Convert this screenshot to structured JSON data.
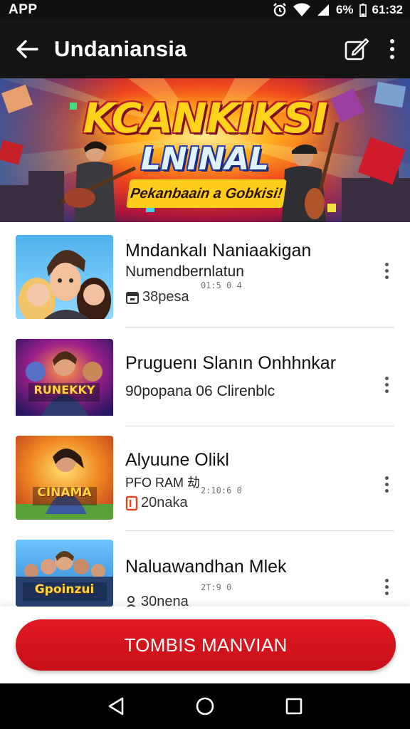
{
  "status_bar": {
    "app_label": "APP",
    "battery_text": "6%",
    "time": "61:32"
  },
  "app_bar": {
    "title": "Undaniansia"
  },
  "banner": {
    "title_line1": "KCANKIKSI",
    "title_line2": "LNINAL",
    "subtitle": "Pekanbaain a Gobkisi!"
  },
  "items": [
    {
      "title": "Mndankalı Naniaakigan",
      "subtitle": "Numendbernlatun",
      "tiny": "01:5 0 4",
      "meta_text": "38pesa",
      "meta_icon": "store-icon"
    },
    {
      "title": "Pruguenı Slanın Onhhnkar",
      "subtitle": "90popana 06 Clirenblc",
      "tiny": "",
      "meta_text": "",
      "meta_icon": ""
    },
    {
      "title": "Alyuune Olikl",
      "subtitle": "PFO RAM 劫",
      "tiny": "2:10:6 0",
      "meta_text": "20naka",
      "meta_icon": "box-icon"
    },
    {
      "title": "Naluawandhan Mlek",
      "subtitle": "",
      "tiny": "2T:9 0",
      "meta_text": "30nena",
      "meta_icon": "person-icon"
    }
  ],
  "thumb_labels": [
    "",
    "RUNEKKY",
    "CINAMA",
    "Gpoinzui"
  ],
  "cta": {
    "label": "TOMBIS MANVIAN"
  },
  "colors": {
    "accent": "#d41820",
    "app_bar": "#141414"
  }
}
